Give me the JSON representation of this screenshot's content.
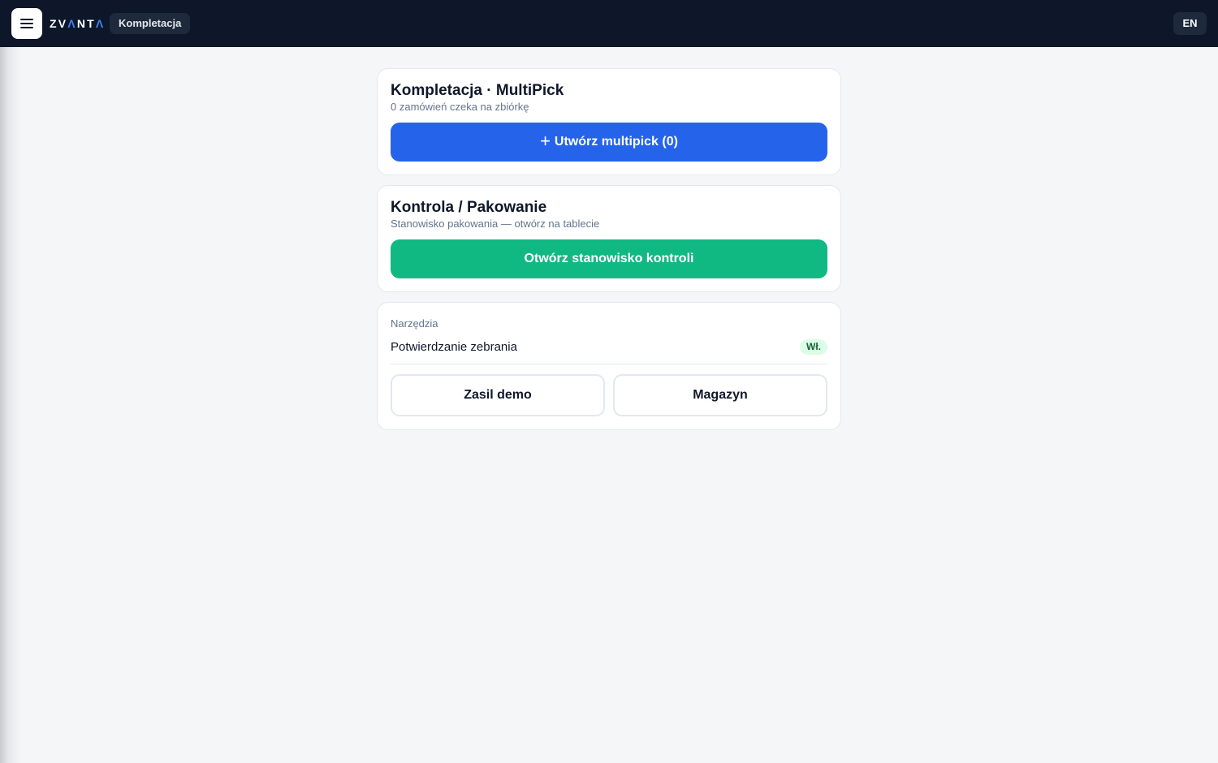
{
  "header": {
    "menu_icon": "hamburger-menu-icon",
    "logo": {
      "part1": "ZV",
      "accent1": "Λ",
      "part2": "NT",
      "accent2": "Λ"
    },
    "module": "Kompletacja",
    "language": "EN"
  },
  "multipick": {
    "title": "Kompletacja · MultiPick",
    "subtitle": "0 zamówień czeka na zbiórkę",
    "button_icon": "plus-icon",
    "button_plus": "+",
    "button_label": "Utwórz multipick (0)"
  },
  "control": {
    "title": "Kontrola / Pakowanie",
    "subtitle": "Stanowisko pakowania — otwórz na tablecie",
    "button_label": "Otwórz stanowisko kontroli"
  },
  "tools": {
    "label": "Narzędzia",
    "items": [
      {
        "name": "Potwierdzanie zebrania",
        "state": "Wł."
      }
    ],
    "buttons": {
      "demo": "Zasil demo",
      "warehouse": "Magazyn"
    }
  },
  "colors": {
    "topbar": "#0e172a",
    "primary_blue": "#2563eb",
    "success_green": "#10b981",
    "logo_accent": "#3b82f6",
    "badge_bg": "#dcfce7",
    "badge_text": "#166534"
  }
}
